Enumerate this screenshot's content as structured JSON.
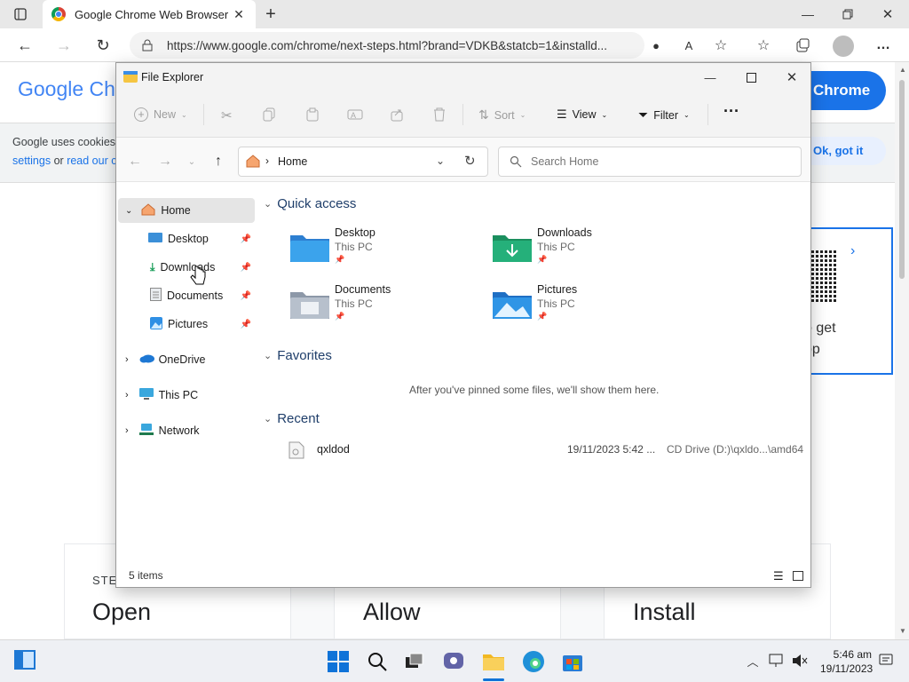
{
  "browser": {
    "tab_title": "Google Chrome Web Browser",
    "url": "https://www.google.com/chrome/next-steps.html?brand=VDKB&statcb=1&installd...",
    "menu": "…"
  },
  "page": {
    "logo": "Google Ch",
    "cookie_line1": "Google uses cookies",
    "cookie_link1": "settings",
    "cookie_or": "or",
    "cookie_link2": "read our c",
    "get_chrome": "Chrome",
    "ok_got_it": "Ok, got it",
    "qr_text1": "o get",
    "qr_text2": "pp",
    "step_label": "STE",
    "step1": "Open",
    "step2": "Allow",
    "step3": "Install"
  },
  "explorer": {
    "title": "File Explorer",
    "cmd": {
      "new": "New",
      "sort": "Sort",
      "view": "View",
      "filter": "Filter"
    },
    "breadcrumb": "Home",
    "search_placeholder": "Search Home",
    "nav": {
      "home": "Home",
      "desktop": "Desktop",
      "downloads": "Downloads",
      "documents": "Documents",
      "pictures": "Pictures",
      "onedrive": "OneDrive",
      "thispc": "This PC",
      "network": "Network"
    },
    "sections": {
      "quick_access": "Quick access",
      "favorites": "Favorites",
      "recent": "Recent"
    },
    "quick_access": [
      {
        "name": "Desktop",
        "sub": "This PC"
      },
      {
        "name": "Downloads",
        "sub": "This PC"
      },
      {
        "name": "Documents",
        "sub": "This PC"
      },
      {
        "name": "Pictures",
        "sub": "This PC"
      }
    ],
    "favorites_empty": "After you've pinned some files, we'll show them here.",
    "recent": [
      {
        "name": "qxldod",
        "date": "19/11/2023 5:42 ...",
        "location": "CD Drive (D:)\\qxldo...\\amd64"
      }
    ],
    "status": "5 items"
  },
  "taskbar": {
    "time": "5:46 am",
    "date": "19/11/2023"
  }
}
